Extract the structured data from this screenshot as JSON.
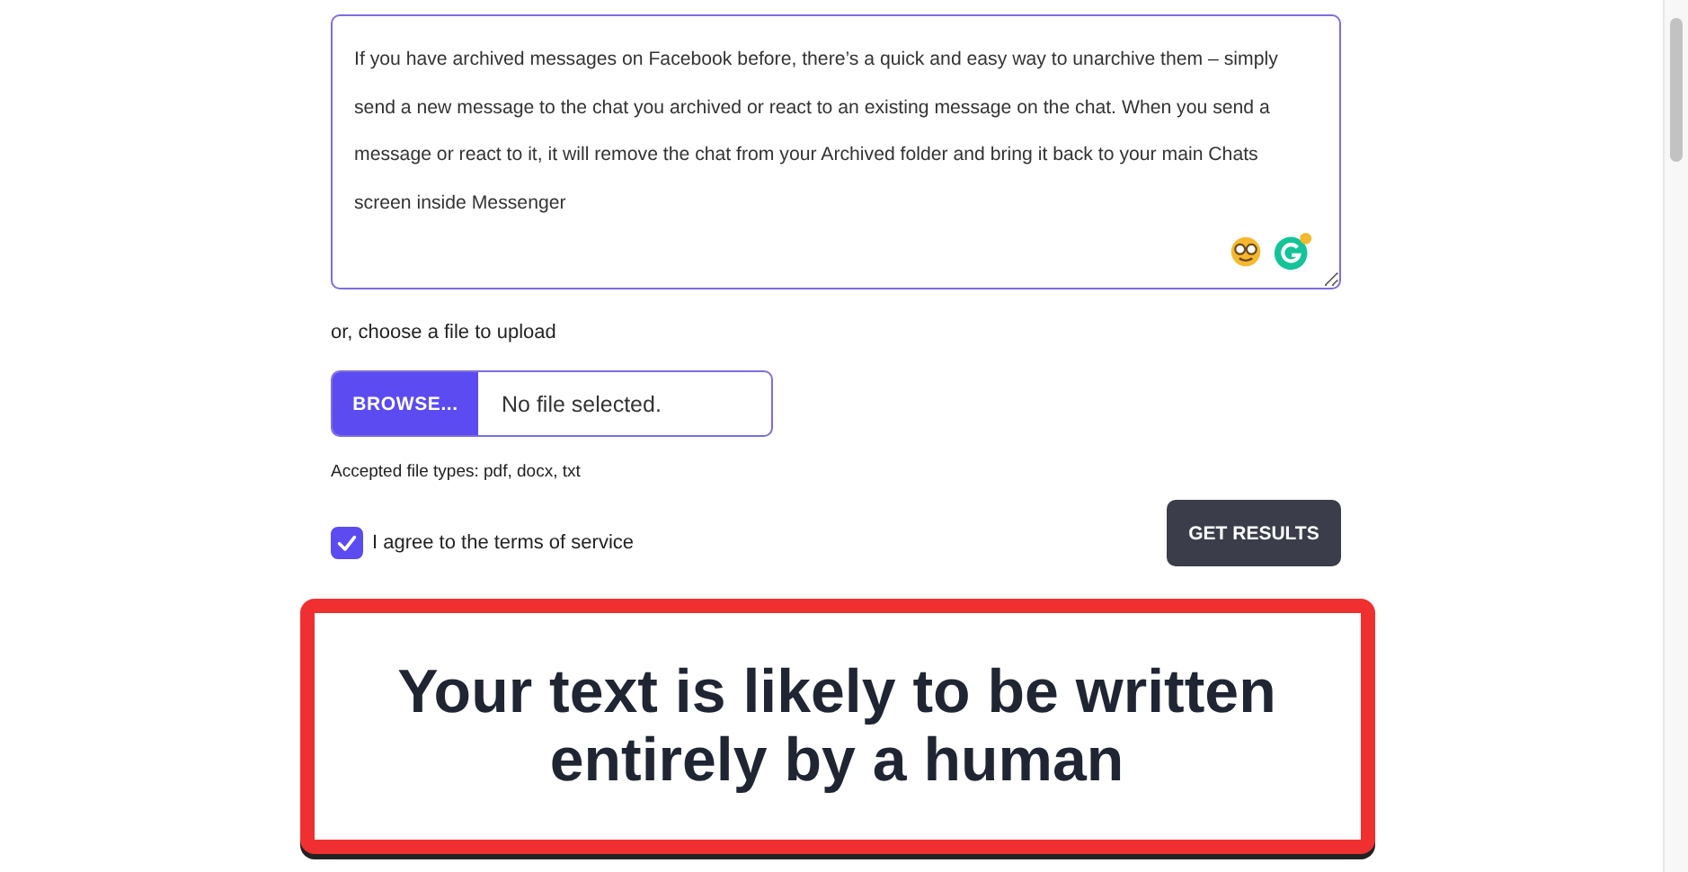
{
  "text_input": {
    "value": "If you have archived messages on Facebook before, there’s a quick and easy way to unarchive them – simply send a new message to the chat you archived or react to an existing message on the chat. When you send a message or react to it, it will remove the chat from your Archived folder and bring it back to your main Chats screen inside Messenger"
  },
  "upload": {
    "label": "or, choose a file to upload",
    "button": "BROWSE...",
    "file_name": "No file selected.",
    "hint": "Accepted file types: pdf, docx, txt"
  },
  "terms": {
    "label": "I agree to the terms of service",
    "checked": true
  },
  "submit_button": "GET RESULTS",
  "result": {
    "message": "Your text is likely to be written entirely by a human"
  }
}
